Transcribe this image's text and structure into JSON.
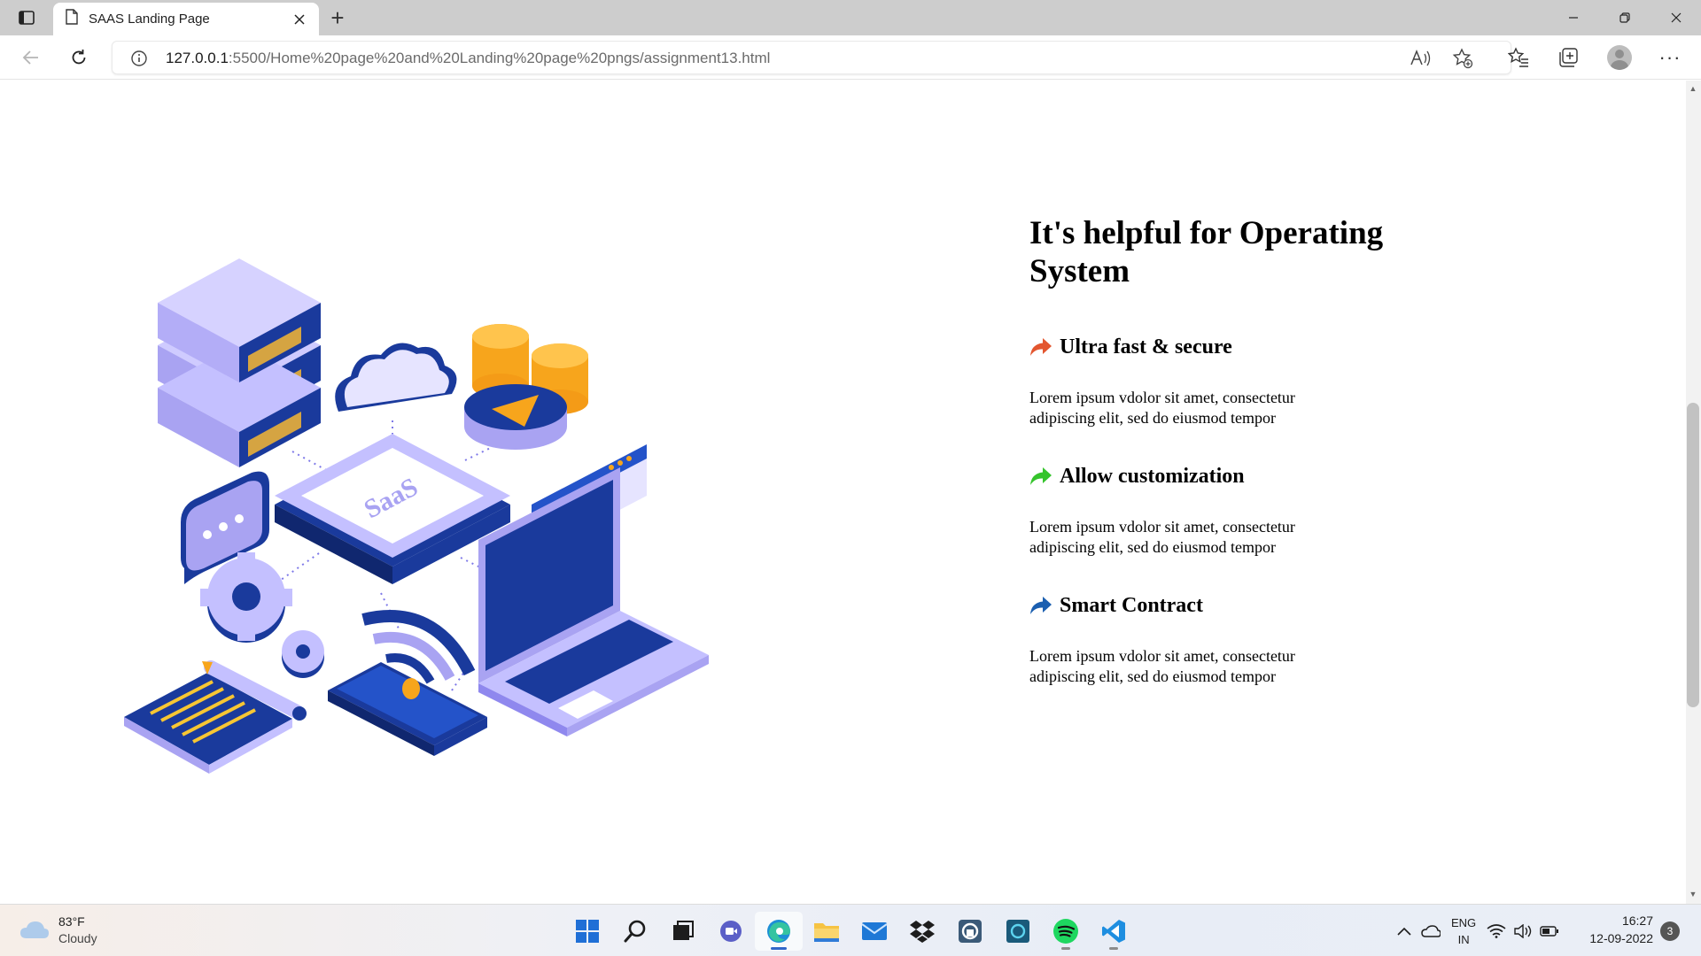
{
  "browser": {
    "tab_title": "SAAS Landing Page",
    "url_host": "127.0.0.1",
    "url_rest": ":5500/Home%20page%20and%20Landing%20page%20pngs/assignment13.html",
    "new_tab_label": "+",
    "menu_label": "···"
  },
  "page": {
    "heading": "It's helpful for Operating System",
    "illustration_label": "SaaS",
    "features": [
      {
        "title": "Ultra fast & secure",
        "icon": "share-arrow-icon",
        "color": "#e3562f",
        "text": "Lorem ipsum vdolor sit amet, consectetur adipiscing elit, sed do eiusmod tempor"
      },
      {
        "title": "Allow customization",
        "icon": "share-arrow-icon",
        "color": "#35c42c",
        "text": "Lorem ipsum vdolor sit amet, consectetur adipiscing elit, sed do eiusmod tempor"
      },
      {
        "title": "Smart Contract",
        "icon": "share-arrow-icon",
        "color": "#1b5fb0",
        "text": "Lorem ipsum vdolor sit amet, consectetur adipiscing elit, sed do eiusmod tempor"
      }
    ]
  },
  "taskbar": {
    "weather_temp": "83°F",
    "weather_cond": "Cloudy",
    "lang_top": "ENG",
    "lang_bottom": "IN",
    "time": "16:27",
    "date": "12-09-2022",
    "notification_count": "3",
    "apps": [
      "start-icon",
      "search-icon",
      "task-view-icon",
      "teams-chat-icon",
      "edge-icon",
      "file-explorer-icon",
      "mail-icon",
      "dropbox-icon",
      "app-icon",
      "alexa-icon",
      "spotify-icon",
      "vscode-icon"
    ]
  },
  "colors": {
    "tabbar_bg": "#cdcdcd",
    "illustration_primary": "#1a3a9c",
    "illustration_secondary": "#a9a3f2",
    "coins": "#f7a51c"
  }
}
